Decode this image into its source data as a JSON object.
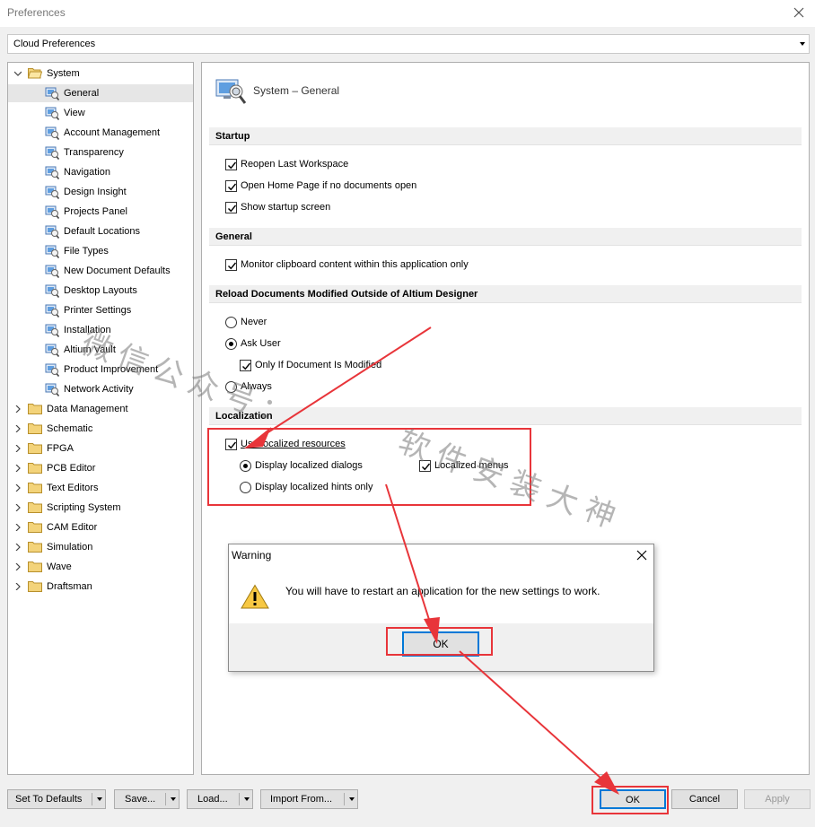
{
  "window": {
    "title": "Preferences"
  },
  "profile": {
    "selected": "Cloud Preferences"
  },
  "tree": {
    "system": {
      "label": "System",
      "children": [
        "General",
        "View",
        "Account Management",
        "Transparency",
        "Navigation",
        "Design Insight",
        "Projects Panel",
        "Default Locations",
        "File Types",
        "New Document Defaults",
        "Desktop Layouts",
        "Printer Settings",
        "Installation",
        "Altium Vault",
        "Product Improvement",
        "Network Activity"
      ],
      "selected": "General"
    },
    "others": [
      "Data Management",
      "Schematic",
      "FPGA",
      "PCB Editor",
      "Text Editors",
      "Scripting System",
      "CAM Editor",
      "Simulation",
      "Wave",
      "Draftsman"
    ]
  },
  "panel": {
    "title": "System – General",
    "startup": {
      "header": "Startup",
      "reopen": "Reopen Last Workspace",
      "home": "Open Home Page if no documents open",
      "splash": "Show startup screen"
    },
    "general": {
      "header": "General",
      "clipboard": "Monitor clipboard content within this application only"
    },
    "reload": {
      "header": "Reload Documents Modified Outside of Altium Designer",
      "never": "Never",
      "ask": "Ask User",
      "only_if": "Only If Document Is Modified",
      "always": "Always",
      "selected": "Ask User"
    },
    "localization": {
      "header": "Localization",
      "use_localized": "Use localized resources",
      "dialogs": "Display localized dialogs",
      "hints": "Display localized hints only",
      "menus": "Localized menus"
    }
  },
  "buttons": {
    "defaults": "Set To Defaults",
    "save": "Save...",
    "load": "Load...",
    "import": "Import From...",
    "ok": "OK",
    "cancel": "Cancel",
    "apply": "Apply"
  },
  "warning": {
    "title": "Warning",
    "message": "You will have to restart an application for the new settings to work.",
    "ok": "OK"
  },
  "watermark": {
    "line1": "微信公众号：",
    "line2": "软件安装大神"
  },
  "colors": {
    "accent": "#0078d7",
    "annotation": "#e8353a",
    "selected_row": "#e6e6e6"
  }
}
